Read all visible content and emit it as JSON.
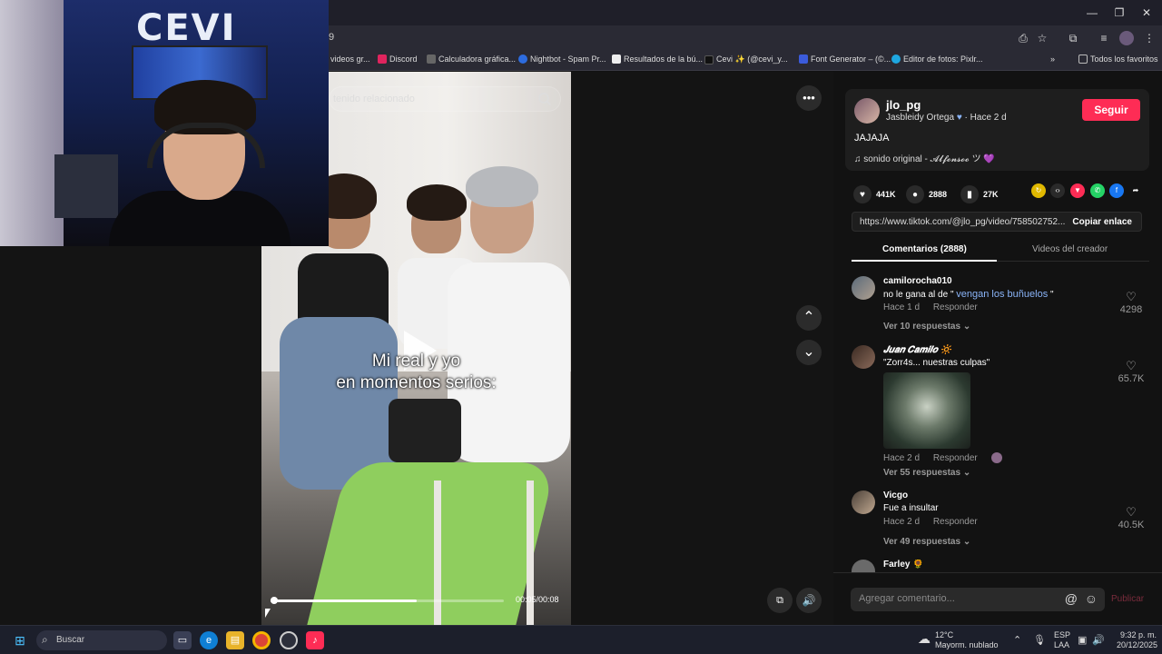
{
  "browser": {
    "url_fragment": "9",
    "window_controls": [
      "—",
      "❐",
      "✕"
    ],
    "bookmarks": [
      {
        "label": "videos gr...",
        "color": "#777"
      },
      {
        "label": "Discord",
        "color": "#e0245e"
      },
      {
        "label": "Calculadora gráfica...",
        "color": "#666"
      },
      {
        "label": "Nightbot - Spam Pr...",
        "color": "#2d6cdf"
      },
      {
        "label": "Resultados de la bú...",
        "color": "#eee"
      },
      {
        "label": "Cevi ✨ (@cevi_y...",
        "color": "#111"
      },
      {
        "label": "Font Generator – (©...",
        "color": "#3b5bdb"
      },
      {
        "label": "Editor de fotos: Pixlr...",
        "color": "#1ea7e1"
      }
    ],
    "all_bookmarks": "Todos los favoritos"
  },
  "video": {
    "search_placeholder": "tenido relacionado",
    "caption_line1": "Mi real y yo",
    "caption_line2": "en momentos serios:",
    "time": "00:05/00:08",
    "progress": 0.625,
    "more": "•••",
    "up": "⌃",
    "down": "⌄"
  },
  "webcam": {
    "logo": "CEVI"
  },
  "creator": {
    "username": "jlo_pg",
    "display": "Jasbleidy Ortega",
    "time_ago": "· Hace 2 d",
    "follow": "Seguir",
    "description": "JAJAJA",
    "sound": "sonido original - 𝓐𝓵𝓯𝓸𝓷𝓼𝓸𝓸 ツ 💜"
  },
  "stats": {
    "likes": "441K",
    "comments": "2888",
    "saves": "27K"
  },
  "share": {
    "url": "https://www.tiktok.com/@jlo_pg/video/758502752...",
    "copy": "Copiar enlace"
  },
  "tabs": {
    "comments": "Comentarios (2888)",
    "creator_videos": "Videos del creador"
  },
  "comments": [
    {
      "user": "camilorocha010",
      "text": "no le gana al de \"",
      "link": "vengan los buñuelos",
      "text_end": "\"",
      "time": "Hace 1 d",
      "reply": "Responder",
      "replies": "Ver 10 respuestas",
      "likes": "4298"
    },
    {
      "user": "𝑱𝒖𝒂𝒏 𝑪𝒂𝒎𝒊𝒍𝒐 🔆",
      "text": "\"Zorr4s... nuestras culpas\"",
      "time": "Hace 2 d",
      "reply": "Responder",
      "replies": "Ver 55 respuestas",
      "likes": "65.7K"
    },
    {
      "user": "Vicgo",
      "text": "Fue a insultar",
      "time": "Hace 2 d",
      "reply": "Responder",
      "replies": "Ver 49 respuestas",
      "likes": "40.5K"
    },
    {
      "user": "Farley 🌻"
    }
  ],
  "comment_input": {
    "placeholder": "Agregar comentario...",
    "publish": "Publicar"
  },
  "taskbar": {
    "search": "Buscar",
    "weather_temp": "12°C",
    "weather_desc": "Mayorm. nublado",
    "lang1": "ESP",
    "lang2": "LAA",
    "time": "9:32 p. m.",
    "date": "20/12/2025"
  }
}
